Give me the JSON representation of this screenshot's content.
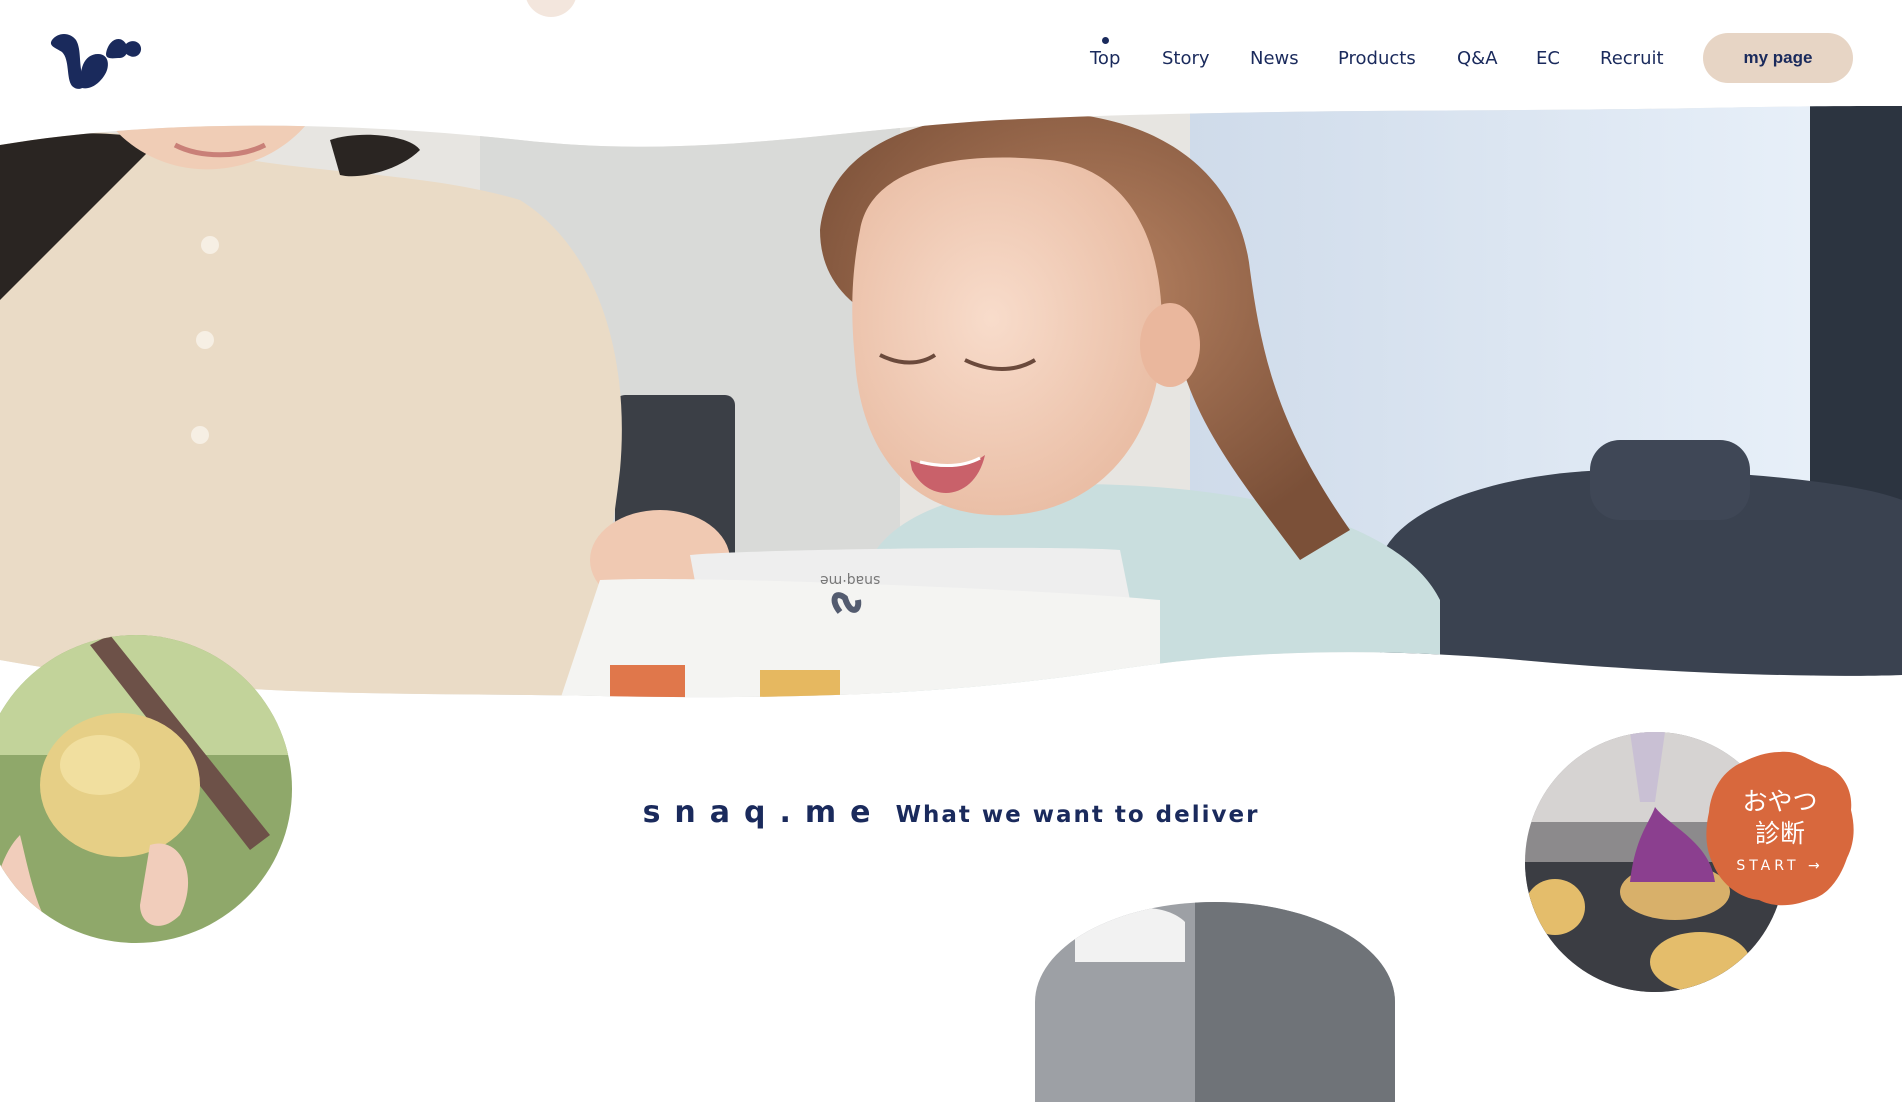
{
  "header": {
    "logo_name": "snaq.me",
    "nav": [
      {
        "label": "Top",
        "active": true
      },
      {
        "label": "Story"
      },
      {
        "label": "News"
      },
      {
        "label": "Products"
      },
      {
        "label": "Q&A"
      },
      {
        "label": "EC"
      },
      {
        "label": "Recruit"
      }
    ],
    "mypage_label": "my page"
  },
  "hero": {
    "box_print": "snaq·me"
  },
  "tagline": {
    "brand": "snaq.me",
    "sub": "What we want to deliver"
  },
  "diagnosis": {
    "line1": "おやつ",
    "line2": "診断",
    "start": "START →"
  },
  "colors": {
    "navy": "#1a2a5c",
    "accent_beige": "#e7d5c5",
    "badge_orange": "#d8683d"
  }
}
